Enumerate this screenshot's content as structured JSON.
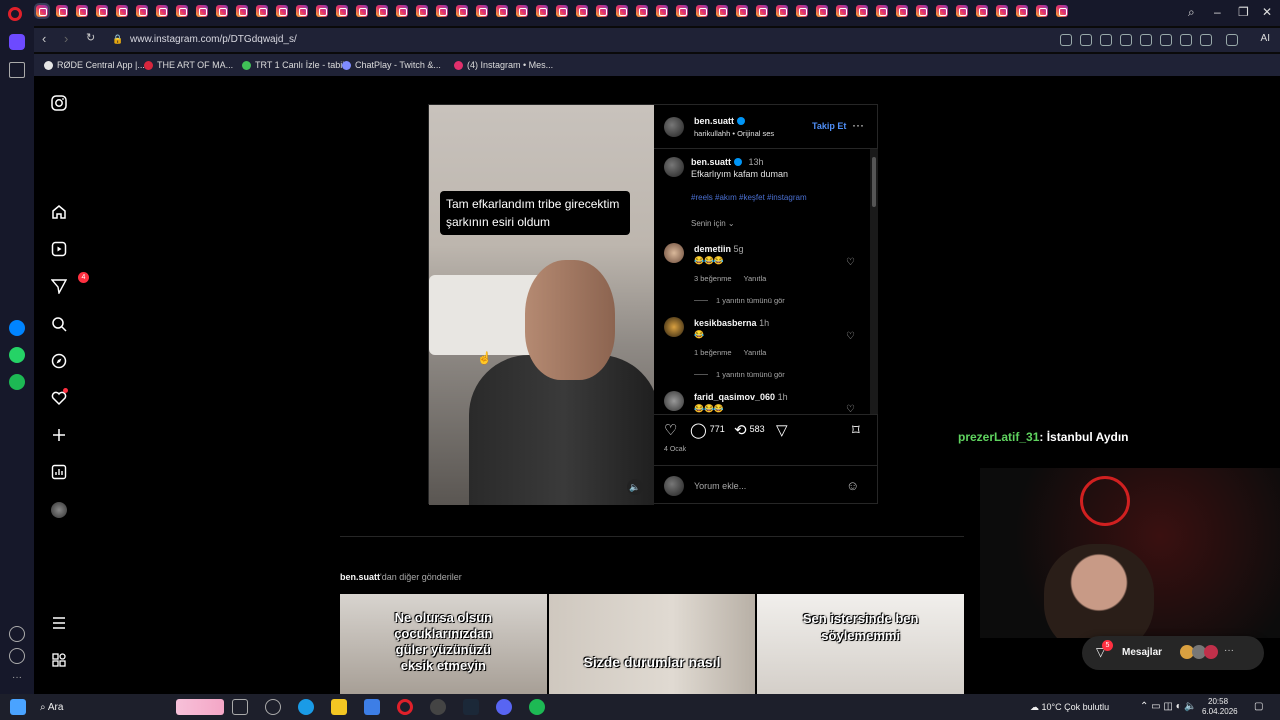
{
  "browser": {
    "url": "www.instagram.com/p/DTGdqwajd_s/",
    "ai_label": "AI"
  },
  "bookmarks": [
    {
      "label": "RØDE Central App |...",
      "color": "#e6e6e6"
    },
    {
      "label": "THE ART OF MA...",
      "color": "#d7263d"
    },
    {
      "label": "TRT 1 Canlı İzle - tabii",
      "color": "#40c057"
    },
    {
      "label": "ChatPlay - Twitch &...",
      "color": "#7f8cff"
    },
    {
      "label": "(4) Instagram • Mes...",
      "color": "#e1306c"
    }
  ],
  "instagram": {
    "notif_badge": "4",
    "post": {
      "username": "ben.suatt",
      "audio": "harikullahh • Orijinal ses",
      "follow_label": "Takip Et",
      "time": "13h",
      "caption": "Efkarlıyım kafam duman",
      "hashtags": "#reels #akım #keşfet #instagram",
      "for_you": "Senin için",
      "video_caption_line1": "Tam efkarlandım tribe girecektim",
      "video_caption_line2": "şarkının esiri oldum",
      "comment_count": "771",
      "repost_count": "583",
      "date": "4 Ocak",
      "add_comment_placeholder": "Yorum ekle...",
      "comments": [
        {
          "user": "demetiin",
          "time": "5g",
          "text": "😂😂😂",
          "meta": "3 beğenme",
          "reply": "Yanıtla",
          "view_replies": "1 yanıtın tümünü gör"
        },
        {
          "user": "kesikbasberna",
          "time": "1h",
          "text": "😂",
          "meta": "1 beğenme",
          "reply": "Yanıtla",
          "view_replies": "1 yanıtın tümünü gör"
        },
        {
          "user": "farid_qasimov_060",
          "time": "1h",
          "text": "😂😂😂"
        }
      ]
    },
    "more_posts": {
      "user": "ben.suatt",
      "suffix": "'dan diğer gönderiler",
      "thumbs": [
        {
          "text": "Ne olursa olsun çocuklarınızdan güler yüzünüzü eksik etmeyin"
        },
        {
          "text": "Sizde durumlar nasıl"
        },
        {
          "text": "Sen istersinde ben söylememmi"
        }
      ]
    },
    "messages_label": "Mesajlar",
    "messages_badge": "5"
  },
  "stream": {
    "chat_user": "prezerLatif_31",
    "chat_text": ": İstanbul Aydın"
  },
  "taskbar": {
    "search": "Ara",
    "weather": "10°C  Çok bulutlu",
    "time": "20:58",
    "date": "6.04.2026"
  }
}
